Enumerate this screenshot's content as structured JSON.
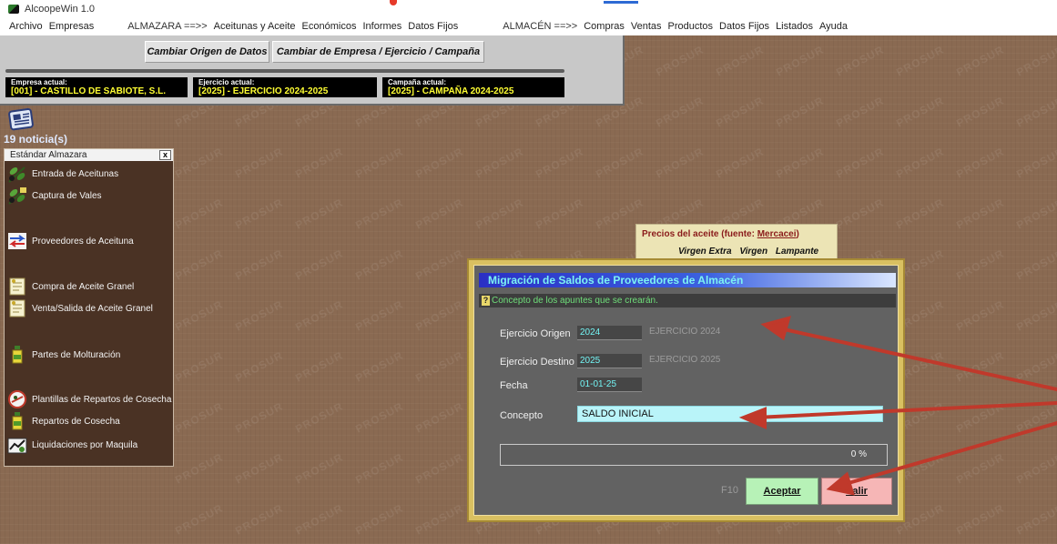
{
  "window": {
    "title": "AlcoopeWin 1.0"
  },
  "menu": {
    "items_left": [
      "Archivo",
      "Empresas"
    ],
    "section_almazara": "ALMAZARA ==>>",
    "items_almazara": [
      "Aceitunas y Aceite",
      "Económicos",
      "Informes",
      "Datos Fijos"
    ],
    "section_almacen": "ALMACÉN ==>>",
    "items_almacen": [
      "Compras",
      "Ventas",
      "Productos",
      "Datos Fijos",
      "Listados",
      "Ayuda"
    ]
  },
  "toolbar": {
    "change_origin": "Cambiar Origen de Datos",
    "change_company": "Cambiar de Empresa / Ejercicio / Campaña"
  },
  "context": {
    "company_label": "Empresa actual:",
    "company_value": "[001] - CASTILLO DE SABIOTE, S.L.",
    "year_label": "Ejercicio actual:",
    "year_value": "[2025] - EJERCICIO 2024-2025",
    "campaign_label": "Campaña actual:",
    "campaign_value": "[2025] - CAMPAÑA 2024-2025"
  },
  "news": {
    "count": "19 noticia(s)",
    "icon": "newspaper-icon"
  },
  "sidebar": {
    "title": "Estándar Almazara",
    "close": "x",
    "items": [
      {
        "label": "Entrada de Aceitunas",
        "icon": "olive-branch-icon"
      },
      {
        "label": "Captura de Vales",
        "icon": "olive-branch-icon"
      },
      {
        "label": "Proveedores de Aceituna",
        "icon": "transfer-arrows-icon"
      },
      {
        "label": "Compra de Aceite Granel",
        "icon": "document-icon"
      },
      {
        "label": "Venta/Salida de Aceite Granel",
        "icon": "document-icon"
      },
      {
        "label": "Partes de Molturación",
        "icon": "oil-bottle-icon"
      },
      {
        "label": "Plantillas de Repartos de Cosecha",
        "icon": "harvest-template-icon"
      },
      {
        "label": "Repartos de Cosecha",
        "icon": "oil-bottle-icon"
      },
      {
        "label": "Liquidaciones por Maquila",
        "icon": "settlement-icon"
      }
    ]
  },
  "prices": {
    "title": "Precios del aceite (fuente: ",
    "source": "Mercacei",
    "title_end": ")",
    "columns": [
      "Virgen Extra",
      "Virgen",
      "Lampante"
    ]
  },
  "dialog": {
    "title": "Migración de Saldos de Proveedores de Almacén",
    "hint": "Concepto de los apuntes que se crearán.",
    "origin_label": "Ejercicio Origen",
    "origin_value": "2024",
    "origin_desc": "EJERCICIO 2024",
    "dest_label": "Ejercicio Destino",
    "dest_value": "2025",
    "dest_desc": "EJERCICIO 2025",
    "date_label": "Fecha",
    "date_value": "01-01-25",
    "concept_label": "Concepto",
    "concept_value": "SALDO INICIAL",
    "progress_text": "0 %",
    "progress": 0,
    "shortcut": "F10",
    "ok_label": "Aceptar",
    "cancel_label": "Salir"
  },
  "watermark": "PROSUR",
  "colors": {
    "background": "#8a6a52",
    "dialog_frame": "#d9c061",
    "arrow": "#c0392b",
    "context_text": "#ffff33"
  }
}
